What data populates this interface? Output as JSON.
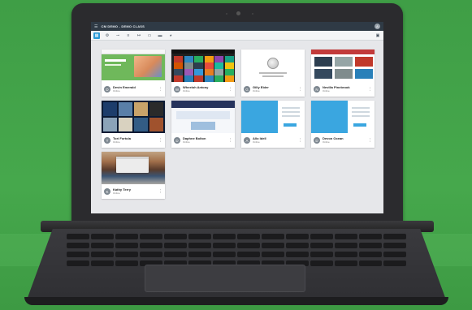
{
  "app": {
    "title": "CM DEMO - DEMO CLASS",
    "account_initial": "A"
  },
  "toolbar": {
    "tools": [
      "grid-view",
      "settings",
      "lock",
      "list",
      "share",
      "tabs",
      "screen",
      "globe"
    ],
    "right_tool": "chat"
  },
  "students": [
    {
      "name": "Devin Emerald",
      "initial": "D",
      "status": "Online",
      "thumb": "green"
    },
    {
      "name": "Wheeloh Antony",
      "initial": "W",
      "status": "Online",
      "thumb": "media"
    },
    {
      "name": "Gilly Elder",
      "initial": "G",
      "status": "Online",
      "thumb": "wiki"
    },
    {
      "name": "Nevilla Pinebrook",
      "initial": "N",
      "status": "Online",
      "thumb": "news"
    },
    {
      "name": "Tori Fortola",
      "initial": "T",
      "status": "Online",
      "thumb": "space"
    },
    {
      "name": "Daphne Bolton",
      "initial": "D",
      "status": "Online",
      "thumb": "webpage"
    },
    {
      "name": "Allo Idell",
      "initial": "A",
      "status": "Online",
      "thumb": "signin"
    },
    {
      "name": "Devon Ocean",
      "initial": "D",
      "status": "Online",
      "thumb": "signin"
    },
    {
      "name": "Kathy Terry",
      "initial": "K",
      "status": "Online",
      "thumb": "mac"
    }
  ],
  "colors": {
    "background": "#46a84c",
    "appbar": "#2f3a45",
    "accent": "#2b9ad6"
  }
}
